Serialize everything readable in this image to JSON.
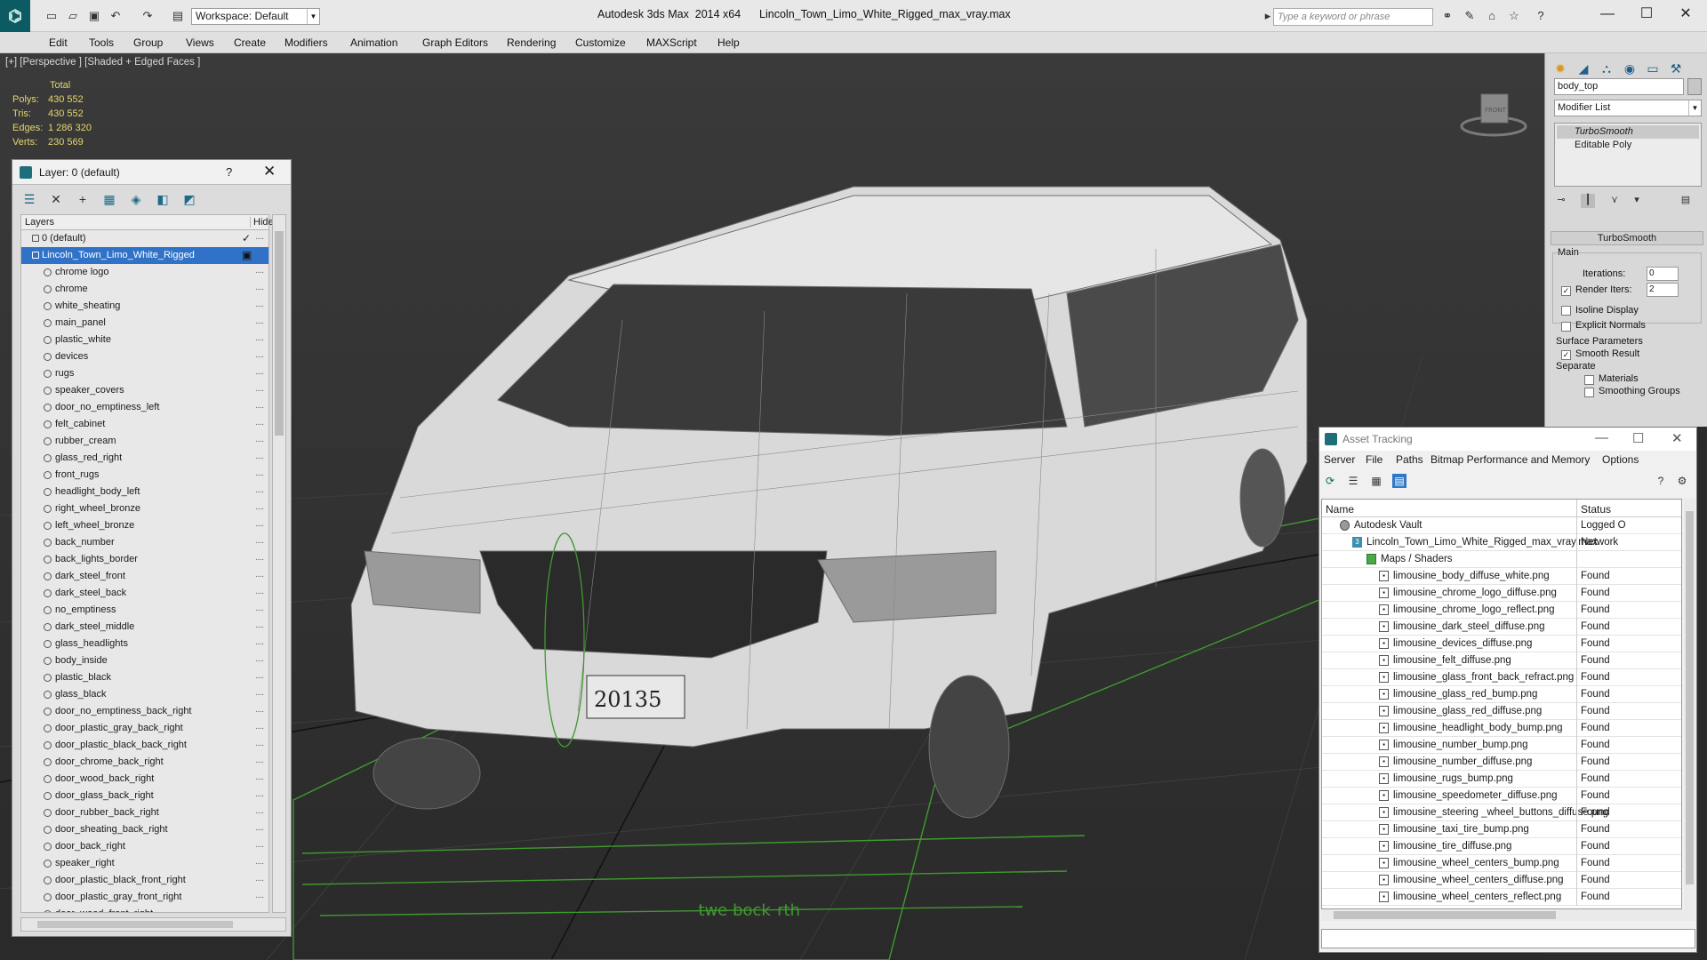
{
  "titlebar": {
    "workspace": "Workspace: Default",
    "title": "Autodesk 3ds Max  2014 x64      Lincoln_Town_Limo_White_Rigged_max_vray.max",
    "search_placeholder": "Type a keyword or phrase"
  },
  "menu": [
    "Edit",
    "Tools",
    "Group",
    "Views",
    "Create",
    "Modifiers",
    "Animation",
    "Graph Editors",
    "Rendering",
    "Customize",
    "MAXScript",
    "Help"
  ],
  "viewport": {
    "label": "[+] [Perspective ] [Shaded + Edged Faces ]",
    "stats": {
      "total_label": "Total",
      "polys_label": "Polys:",
      "polys": "430 552",
      "tris_label": "Tris:",
      "tris": "430 552",
      "edges_label": "Edges:",
      "edges": "1 286 320",
      "verts_label": "Verts:",
      "verts": "230 569"
    },
    "plate_text": "20135",
    "viewcube_label": "FRONT"
  },
  "layer_panel": {
    "title": "Layer: 0 (default)",
    "help": "?",
    "col_layers": "Layers",
    "col_hide": "Hide",
    "top_layers": [
      "0 (default)",
      "Lincoln_Town_Limo_White_Rigged"
    ],
    "layers": [
      "chrome logo",
      "chrome",
      "white_sheating",
      "main_panel",
      "plastic_white",
      "devices",
      "rugs",
      "speaker_covers",
      "door_no_emptiness_left",
      "felt_cabinet",
      "rubber_cream",
      "glass_red_right",
      "front_rugs",
      "headlight_body_left",
      "right_wheel_bronze",
      "left_wheel_bronze",
      "back_number",
      "back_lights_border",
      "dark_steel_front",
      "dark_steel_back",
      "no_emptiness",
      "dark_steel_middle",
      "glass_headlights",
      "body_inside",
      "plastic_black",
      "glass_black",
      "door_no_emptiness_back_right",
      "door_plastic_gray_back_right",
      "door_plastic_black_back_right",
      "door_chrome_back_right",
      "door_wood_back_right",
      "door_glass_back_right",
      "door_rubber_back_right",
      "door_sheating_back_right",
      "door_back_right",
      "speaker_right",
      "door_plastic_black_front_right",
      "door_plastic_gray_front_right",
      "door_wood_front_right"
    ]
  },
  "command_panel": {
    "object_name": "body_top",
    "modifier_list": "Modifier List",
    "stack": [
      "TurboSmooth",
      "Editable Poly"
    ],
    "rollout_title": "TurboSmooth",
    "main_label": "Main",
    "iterations_label": "Iterations:",
    "iterations": "0",
    "render_iters_label": "Render Iters:",
    "render_iters": "2",
    "isoline": "Isoline Display",
    "explicit_normals": "Explicit Normals",
    "surface_params": "Surface Parameters",
    "smooth_result": "Smooth Result",
    "separate": "Separate",
    "materials": "Materials",
    "smoothing_groups": "Smoothing Groups"
  },
  "asset_tracking": {
    "title": "Asset Tracking",
    "menu": [
      "Server",
      "File",
      "Paths",
      "Bitmap Performance and Memory",
      "Options"
    ],
    "col_name": "Name",
    "col_status": "Status",
    "tree": [
      {
        "name": "Autodesk Vault",
        "status": "Logged O",
        "level": 0
      },
      {
        "name": "Lincoln_Town_Limo_White_Rigged_max_vray.max",
        "status": "Network",
        "level": 1
      },
      {
        "name": "Maps / Shaders",
        "status": "",
        "level": 2
      }
    ],
    "files": [
      {
        "name": "limousine_body_diffuse_white.png",
        "status": "Found"
      },
      {
        "name": "limousine_chrome_logo_diffuse.png",
        "status": "Found"
      },
      {
        "name": "limousine_chrome_logo_reflect.png",
        "status": "Found"
      },
      {
        "name": "limousine_dark_steel_diffuse.png",
        "status": "Found"
      },
      {
        "name": "limousine_devices_diffuse.png",
        "status": "Found"
      },
      {
        "name": "limousine_felt_diffuse.png",
        "status": "Found"
      },
      {
        "name": "limousine_glass_front_back_refract.png",
        "status": "Found"
      },
      {
        "name": "limousine_glass_red_bump.png",
        "status": "Found"
      },
      {
        "name": "limousine_glass_red_diffuse.png",
        "status": "Found"
      },
      {
        "name": "limousine_headlight_body_bump.png",
        "status": "Found"
      },
      {
        "name": "limousine_number_bump.png",
        "status": "Found"
      },
      {
        "name": "limousine_number_diffuse.png",
        "status": "Found"
      },
      {
        "name": "limousine_rugs_bump.png",
        "status": "Found"
      },
      {
        "name": "limousine_speedometer_diffuse.png",
        "status": "Found"
      },
      {
        "name": "limousine_steering _wheel_buttons_diffuse.png",
        "status": "Found"
      },
      {
        "name": "limousine_taxi_tire_bump.png",
        "status": "Found"
      },
      {
        "name": "limousine_tire_diffuse.png",
        "status": "Found"
      },
      {
        "name": "limousine_wheel_centers_bump.png",
        "status": "Found"
      },
      {
        "name": "limousine_wheel_centers_diffuse.png",
        "status": "Found"
      },
      {
        "name": "limousine_wheel_centers_reflect.png",
        "status": "Found"
      }
    ]
  }
}
